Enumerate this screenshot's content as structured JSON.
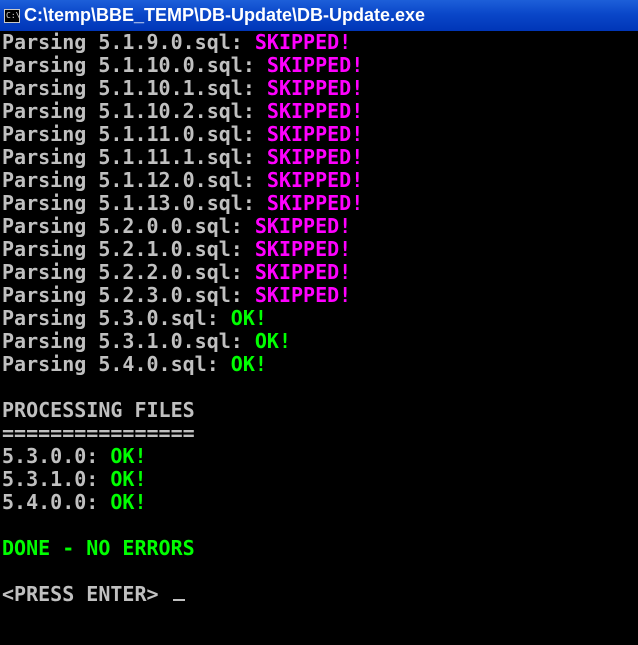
{
  "window": {
    "title": "C:\\temp\\BBE_TEMP\\DB-Update\\DB-Update.exe",
    "icon": "console-icon",
    "icon_glyph": "C:\\"
  },
  "console": {
    "parse_lines": [
      {
        "label": "Parsing 5.1.9.0.sql: ",
        "status": "SKIPPED!"
      },
      {
        "label": "Parsing 5.1.10.0.sql: ",
        "status": "SKIPPED!"
      },
      {
        "label": "Parsing 5.1.10.1.sql: ",
        "status": "SKIPPED!"
      },
      {
        "label": "Parsing 5.1.10.2.sql: ",
        "status": "SKIPPED!"
      },
      {
        "label": "Parsing 5.1.11.0.sql: ",
        "status": "SKIPPED!"
      },
      {
        "label": "Parsing 5.1.11.1.sql: ",
        "status": "SKIPPED!"
      },
      {
        "label": "Parsing 5.1.12.0.sql: ",
        "status": "SKIPPED!"
      },
      {
        "label": "Parsing 5.1.13.0.sql: ",
        "status": "SKIPPED!"
      },
      {
        "label": "Parsing 5.2.0.0.sql: ",
        "status": "SKIPPED!"
      },
      {
        "label": "Parsing 5.2.1.0.sql: ",
        "status": "SKIPPED!"
      },
      {
        "label": "Parsing 5.2.2.0.sql: ",
        "status": "SKIPPED!"
      },
      {
        "label": "Parsing 5.2.3.0.sql: ",
        "status": "SKIPPED!"
      },
      {
        "label": "Parsing 5.3.0.sql: ",
        "status": "OK!"
      },
      {
        "label": "Parsing 5.3.1.0.sql: ",
        "status": "OK!"
      },
      {
        "label": "Parsing 5.4.0.sql: ",
        "status": "OK!"
      }
    ],
    "processing_header": "PROCESSING FILES",
    "processing_underline": "================",
    "processing_lines": [
      {
        "label": "5.3.0.0: ",
        "status": "OK!"
      },
      {
        "label": "5.3.1.0: ",
        "status": "OK!"
      },
      {
        "label": "5.4.0.0: ",
        "status": "OK!"
      }
    ],
    "done_text": "DONE - NO ERRORS",
    "prompt_text": "<PRESS ENTER> "
  },
  "colors": {
    "background": "#000000",
    "text": "#c0c0c0",
    "skipped": "#ff00ff",
    "ok": "#00ff00",
    "titlebar": "#0a47c9"
  }
}
